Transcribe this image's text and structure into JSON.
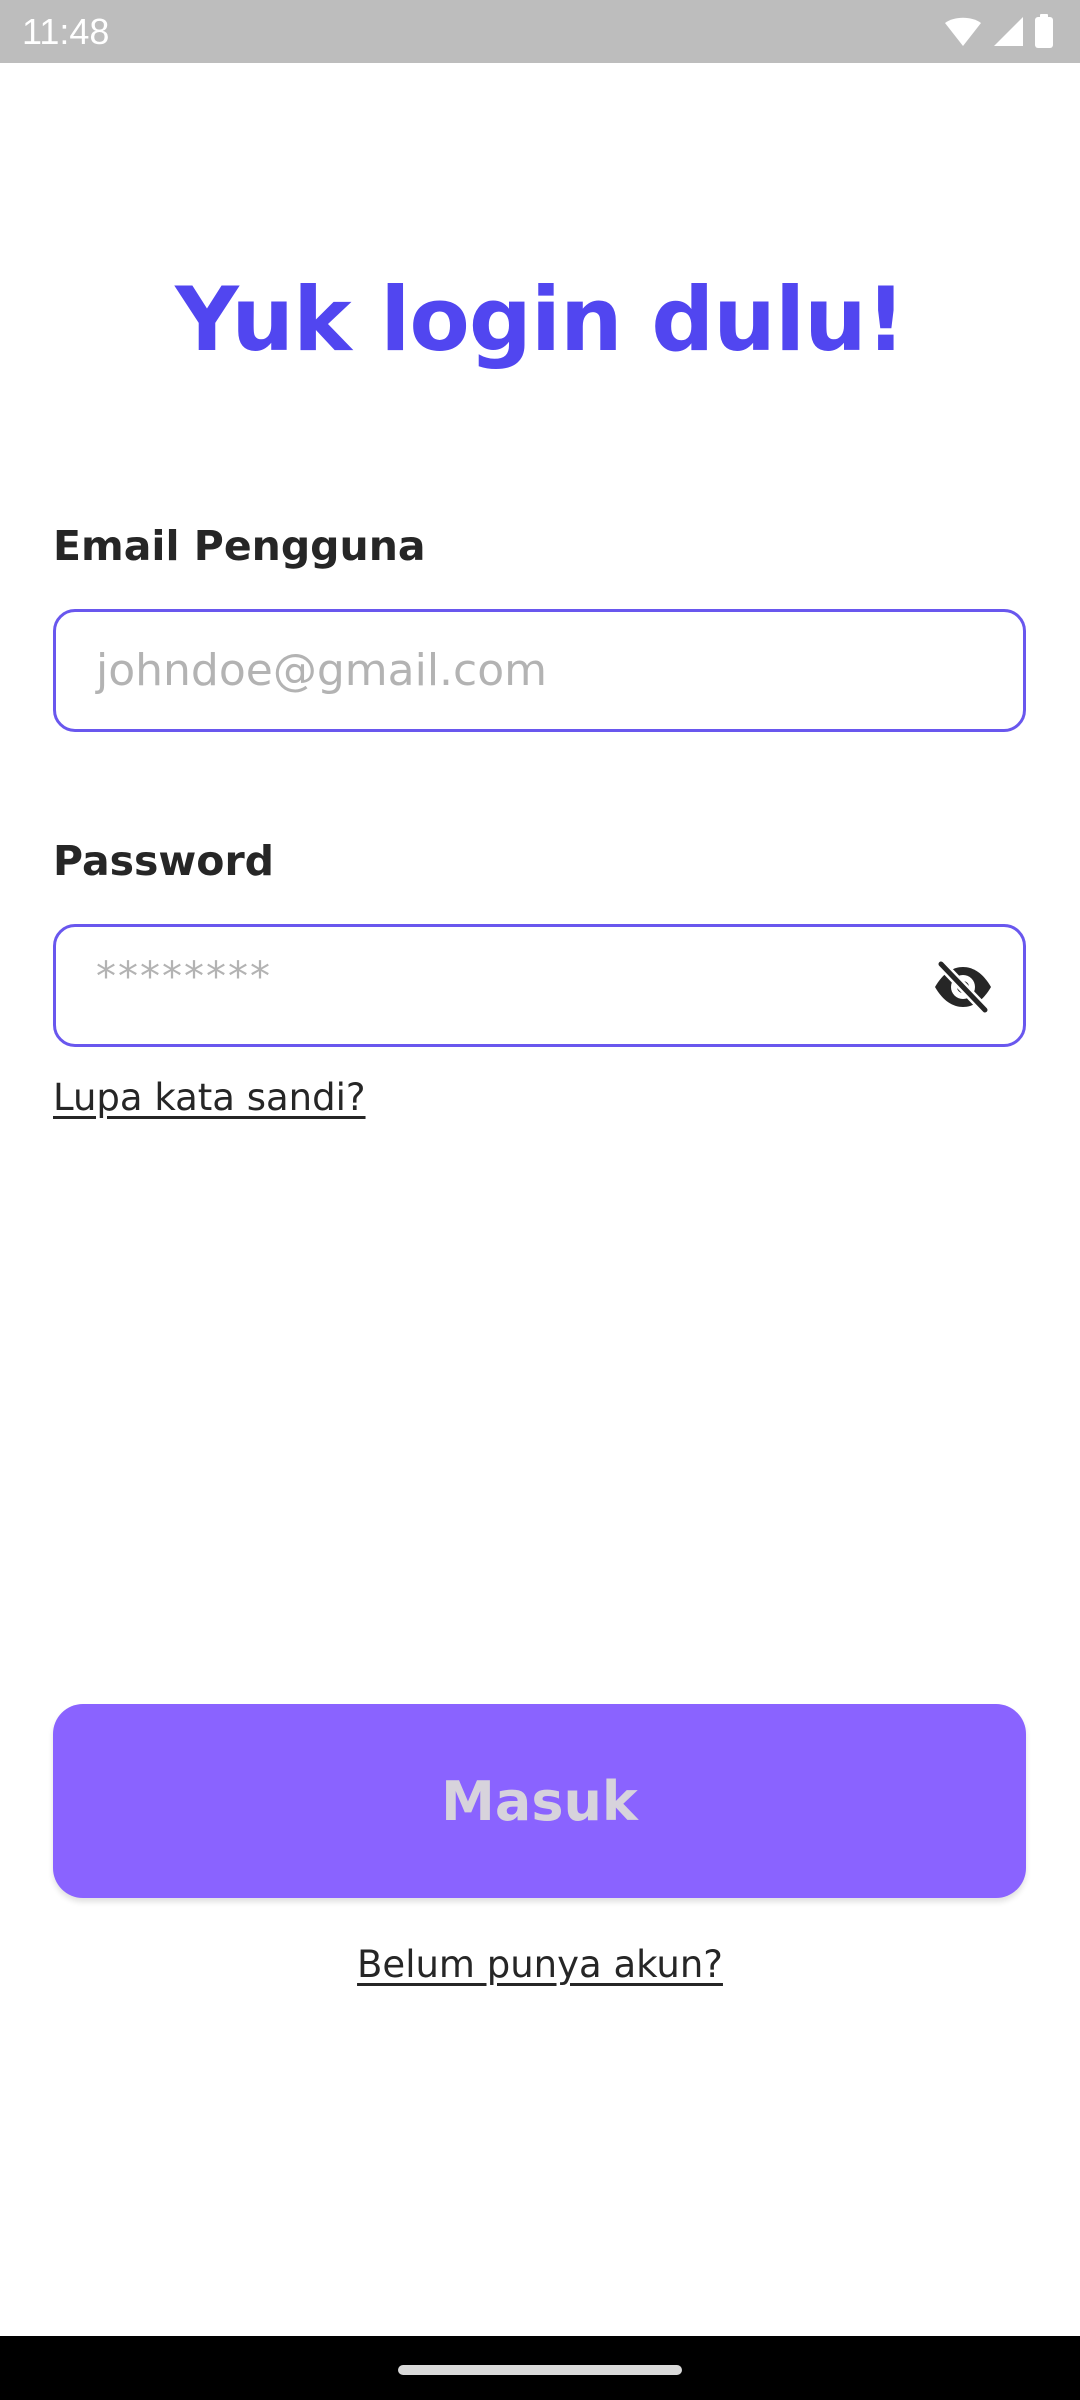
{
  "status_bar": {
    "time": "11:48",
    "icons": [
      "wifi-icon",
      "cellular-signal-icon",
      "battery-icon"
    ]
  },
  "login": {
    "title": "Yuk login dulu!",
    "email": {
      "label": "Email Pengguna",
      "value": "",
      "placeholder": "johndoe@gmail.com"
    },
    "password": {
      "label": "Password",
      "value": "",
      "placeholder": "********",
      "visibility_icon": "eye-off-icon"
    },
    "forgot_password": "Lupa kata sandi?",
    "submit_label": "Masuk",
    "register_link": "Belum punya akun?"
  },
  "colors": {
    "title": "#5146f0",
    "field_border": "#6957ee",
    "button_background": "#8a63ff",
    "button_text": "#d7d3dc",
    "status_bar": "#bdbdbd",
    "navigation_bar": "#000000"
  }
}
